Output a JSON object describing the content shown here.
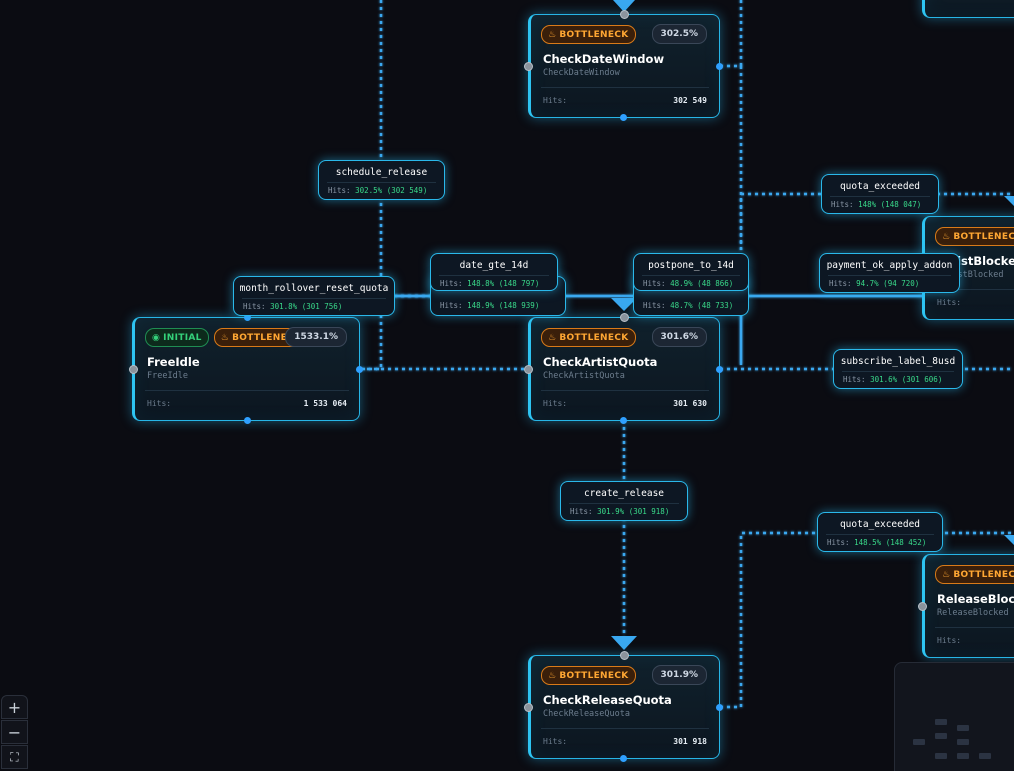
{
  "badges": {
    "bottleneck": "BOTTLENECK",
    "initial": "INITIAL",
    "hits_label": "Hits:"
  },
  "nodes": {
    "free_idle": {
      "title": "FreeIdle",
      "subtitle": "FreeIdle",
      "percent": "1533.1%",
      "hits": "1 533 064"
    },
    "check_date_window": {
      "title": "CheckDateWindow",
      "subtitle": "CheckDateWindow",
      "percent": "302.5%",
      "hits": "302 549"
    },
    "check_artist_quota": {
      "title": "CheckArtistQuota",
      "subtitle": "CheckArtistQuota",
      "percent": "301.6%",
      "hits": "301 630"
    },
    "check_release_quota": {
      "title": "CheckReleaseQuota",
      "subtitle": "CheckReleaseQuota",
      "percent": "301.9%",
      "hits": "301 918"
    },
    "artist_blocked": {
      "title": "ArtistBlocked",
      "subtitle": "ArtistBlocked"
    },
    "release_blocked": {
      "title": "ReleaseBlocked",
      "subtitle": "ReleaseBlocked"
    }
  },
  "edges": {
    "schedule_release": {
      "label": "schedule_release",
      "hits": "302.5% (302 549)"
    },
    "month_rollover_reset_quota": {
      "label": "month_rollover_reset_quota",
      "hits": "301.8% (301 756)"
    },
    "date_gte_14d": {
      "label": "date_gte_14d",
      "hits": "148.8% (148 797)"
    },
    "date_gte_14d_back": {
      "hits": "148.9% (148 939)"
    },
    "postpone_to_14d": {
      "label": "postpone_to_14d",
      "hits": "48.9% (48 866)"
    },
    "postpone_to_14d_back": {
      "hits": "48.7% (48 733)"
    },
    "quota_exceeded_artist": {
      "label": "quota_exceeded",
      "hits": "148% (148 047)"
    },
    "payment_ok_apply_addon": {
      "label": "payment_ok_apply_addon",
      "hits": "94.7% (94 720)"
    },
    "subscribe_label_8usd": {
      "label": "subscribe_label_8usd",
      "hits": "301.6% (301 606)"
    },
    "create_release": {
      "label": "create_release",
      "hits": "301.9% (301 918)"
    },
    "quota_exceeded_release": {
      "label": "quota_exceeded",
      "hits": "148.5% (148 452)"
    }
  },
  "controls": {
    "zoom_in": "+",
    "zoom_out": "−",
    "fit": "⛶"
  },
  "colors": {
    "edge": "#3aa8f0",
    "node_border": "#27b5e6",
    "bottleneck": "#ffa733",
    "initial": "#34d17a",
    "hits_value": "#39d98a"
  },
  "icons": {
    "bottleneck": "flame-icon",
    "initial": "play-circle-icon"
  }
}
